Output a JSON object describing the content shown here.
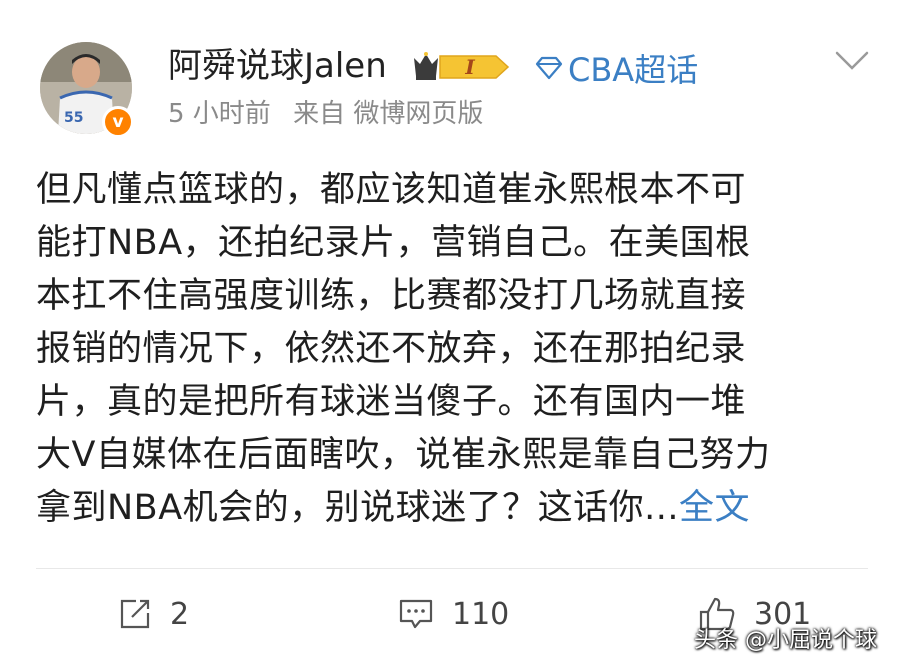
{
  "post": {
    "author": "阿舜说球Jalen",
    "level_badge": "I",
    "topic": "CBA超话",
    "time": "5 小时前",
    "source": "来自 微博网页版",
    "lines": [
      "但凡懂点篮球的，都应该知道崔永熙根本不可",
      "能打NBA，还拍纪录片，营销自己。在美国根",
      "本扛不住高强度训练，比赛都没打几场就直接",
      "报销的情况下，依然还不放弃，还在那拍纪录",
      "片，真的是把所有球迷当傻子。还有国内一堆",
      "大V自媒体在后面瞎吹，说崔永熙是靠自己努力",
      "拿到NBA机会的，别说球迷了？这话你..."
    ],
    "full_text_link": "全文",
    "avatar_jersey": "55",
    "verified_mark": "v"
  },
  "actions": {
    "repost_count": "2",
    "comment_count": "110",
    "like_count": "301"
  },
  "watermark": "头条 @小屈说个球",
  "icons": {
    "repost": "repost-icon",
    "comment": "comment-icon",
    "like": "thumbs-up-icon",
    "chevron": "chevron-down-icon",
    "topic": "diamond-icon",
    "verified": "verified-badge-icon",
    "level": "crown-level-badge"
  },
  "colors": {
    "link": "#3b7fc4",
    "meta": "#8a8a8a",
    "verified": "#ff8200",
    "level_badge_bg": "#f5c433"
  }
}
